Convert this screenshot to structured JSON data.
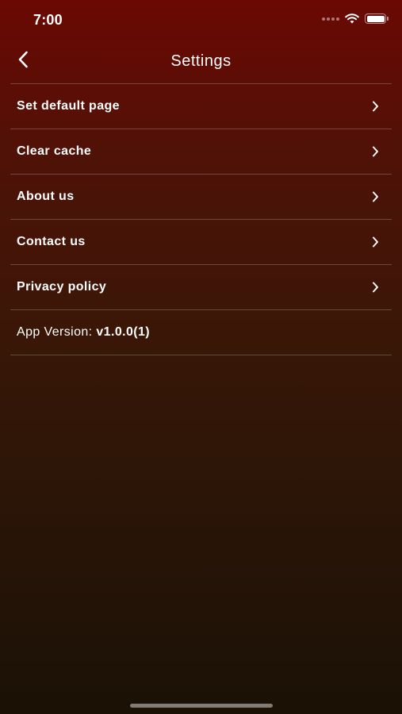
{
  "status_bar": {
    "time": "7:00",
    "icons": [
      "signal-icon",
      "wifi-icon",
      "battery-icon"
    ],
    "battery_level": 1.0
  },
  "nav": {
    "back_icon": "chevron-left-icon",
    "title": "Settings"
  },
  "settings": {
    "items": [
      {
        "label": "Set default page",
        "icon": "chevron-right-icon"
      },
      {
        "label": "Clear cache",
        "icon": "chevron-right-icon"
      },
      {
        "label": "About us",
        "icon": "chevron-right-icon"
      },
      {
        "label": "Contact us",
        "icon": "chevron-right-icon"
      },
      {
        "label": "Privacy policy",
        "icon": "chevron-right-icon"
      }
    ],
    "version": {
      "label": "App Version: ",
      "value": "v1.0.0(1)"
    }
  },
  "colors": {
    "background_top": "#6b0803",
    "background_bottom": "#1b1105",
    "text": "#ffffff",
    "divider": "rgba(255,255,255,0.22)"
  }
}
